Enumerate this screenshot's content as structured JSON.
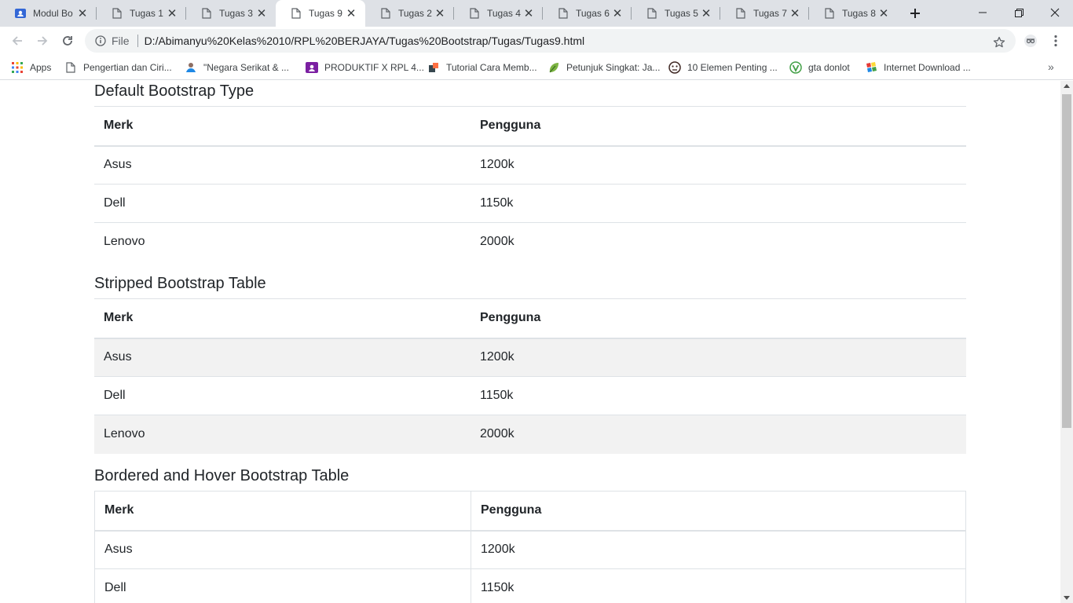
{
  "browser": {
    "tabs": [
      {
        "title": "Modul Bo",
        "icon": "blue-doc-icon",
        "active": false
      },
      {
        "title": "Tugas 1",
        "icon": "page-icon",
        "active": false
      },
      {
        "title": "Tugas 3",
        "icon": "page-icon",
        "active": false
      },
      {
        "title": "Tugas 9",
        "icon": "page-icon",
        "active": true
      },
      {
        "title": "Tugas 2",
        "icon": "page-icon",
        "active": false
      },
      {
        "title": "Tugas 4",
        "icon": "page-icon",
        "active": false
      },
      {
        "title": "Tugas 6",
        "icon": "page-icon",
        "active": false
      },
      {
        "title": "Tugas 5",
        "icon": "page-icon",
        "active": false
      },
      {
        "title": "Tugas 7",
        "icon": "page-icon",
        "active": false
      },
      {
        "title": "Tugas 8",
        "icon": "page-icon",
        "active": false
      }
    ],
    "address": {
      "scheme_label": "File",
      "url": "D:/Abimanyu%20Kelas%2010/RPL%20BERJAYA/Tugas%20Bootstrap/Tugas/Tugas9.html"
    },
    "bookmarks": [
      {
        "label": "Apps",
        "icon": "apps-grid-icon"
      },
      {
        "label": "Pengertian dan Ciri...",
        "icon": "page-icon"
      },
      {
        "label": "\"Negara Serikat & ...",
        "icon": "person-icon"
      },
      {
        "label": "PRODUKTIF X RPL 4...",
        "icon": "classroom-icon"
      },
      {
        "label": "Tutorial Cara Memb...",
        "icon": "site-icon"
      },
      {
        "label": "Petunjuk Singkat: Ja...",
        "icon": "leaf-icon"
      },
      {
        "label": "10 Elemen Penting ...",
        "icon": "face-icon"
      },
      {
        "label": "gta donlot",
        "icon": "v-logo-icon"
      },
      {
        "label": "Internet Download ...",
        "icon": "idm-icon"
      }
    ]
  },
  "page": {
    "sections": [
      {
        "title": "Default Bootstrap Type",
        "headers": [
          "Merk",
          "Pengguna"
        ],
        "rows": [
          [
            "Asus",
            "1200k"
          ],
          [
            "Dell",
            "1150k"
          ],
          [
            "Lenovo",
            "2000k"
          ]
        ]
      },
      {
        "title": "Stripped Bootstrap Table",
        "headers": [
          "Merk",
          "Pengguna"
        ],
        "rows": [
          [
            "Asus",
            "1200k"
          ],
          [
            "Dell",
            "1150k"
          ],
          [
            "Lenovo",
            "2000k"
          ]
        ]
      },
      {
        "title": "Bordered and Hover Bootstrap Table",
        "headers": [
          "Merk",
          "Pengguna"
        ],
        "rows": [
          [
            "Asus",
            "1200k"
          ],
          [
            "Dell",
            "1150k"
          ]
        ]
      }
    ]
  },
  "colors": {
    "tabstrip_bg": "#dee1e6",
    "stripe_bg": "#f2f2f2",
    "border": "#dee2e6",
    "text": "#212529"
  }
}
